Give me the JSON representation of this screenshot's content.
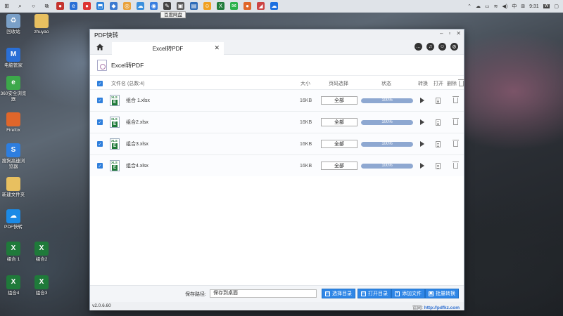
{
  "taskbar": {
    "tooltip": "百度网盘",
    "time": "9:31",
    "ime": "中",
    "tray_badge": "W"
  },
  "desktop": {
    "icons": [
      {
        "label": "回收站",
        "color": "#7aa0c8",
        "glyph": "♻"
      },
      {
        "label": "zhuyao",
        "color": "#e8c060",
        "glyph": ""
      },
      {
        "label": "电脑管家",
        "color": "#2a6fd6",
        "glyph": "M"
      },
      {
        "label": "360安全浏览器",
        "color": "#3ca84a",
        "glyph": "e"
      },
      {
        "label": "Firefox",
        "color": "#e0662a",
        "glyph": ""
      },
      {
        "label": "搜狗高速浏览器",
        "color": "#2d7ee0",
        "glyph": "S"
      },
      {
        "label": "新建文件夹",
        "color": "#e8c060",
        "glyph": ""
      },
      {
        "label": "PDF快转",
        "color": "#1b8ae6",
        "glyph": "☁"
      },
      {
        "label": "组合 1",
        "color": "#1f7a3a",
        "glyph": "X"
      },
      {
        "label": "组合2",
        "color": "#1f7a3a",
        "glyph": "X"
      },
      {
        "label": "组合4",
        "color": "#1f7a3a",
        "glyph": "X"
      },
      {
        "label": "组合3",
        "color": "#1f7a3a",
        "glyph": "X"
      }
    ]
  },
  "window": {
    "title": "PDF快转",
    "controls": {
      "minimize": "–",
      "restore": "▫",
      "close": "✕"
    },
    "tab_label": "Excel转PDF",
    "tab_close": "✕",
    "page_title": "Excel转PDF",
    "table": {
      "headers": {
        "name": "文件名 (总数:4)",
        "size": "大小",
        "pages": "页码选择",
        "status": "状态",
        "convert": "转换",
        "open": "打开",
        "delete": "删除"
      },
      "rows": [
        {
          "name": "组合 1.xlsx",
          "size": "16KB",
          "pages": "全部",
          "status": "100%",
          "progress": 1.0
        },
        {
          "name": "组合2.xlsx",
          "size": "16KB",
          "pages": "全部",
          "status": "100%",
          "progress": 1.0
        },
        {
          "name": "组合3.xlsx",
          "size": "16KB",
          "pages": "全部",
          "status": "100%",
          "progress": 1.0
        },
        {
          "name": "组合4.xlsx",
          "size": "16KB",
          "pages": "全部",
          "status": "100%",
          "progress": 1.0
        }
      ]
    },
    "bottom": {
      "save_label": "保存路径:",
      "save_value": "保存到桌面",
      "buttons": {
        "choose_dir": "选择目录",
        "open_dir": "打开目录",
        "add_file": "添加文件",
        "batch_convert": "批量转换"
      }
    },
    "status": {
      "version": "v2.0.6.60",
      "website_label": "官网:",
      "website": "http://pdfkz.com"
    }
  },
  "colors": {
    "accent": "#2f86e6",
    "progress_fill": "#8ea8d1",
    "checkbox": "#2f7fdc"
  }
}
